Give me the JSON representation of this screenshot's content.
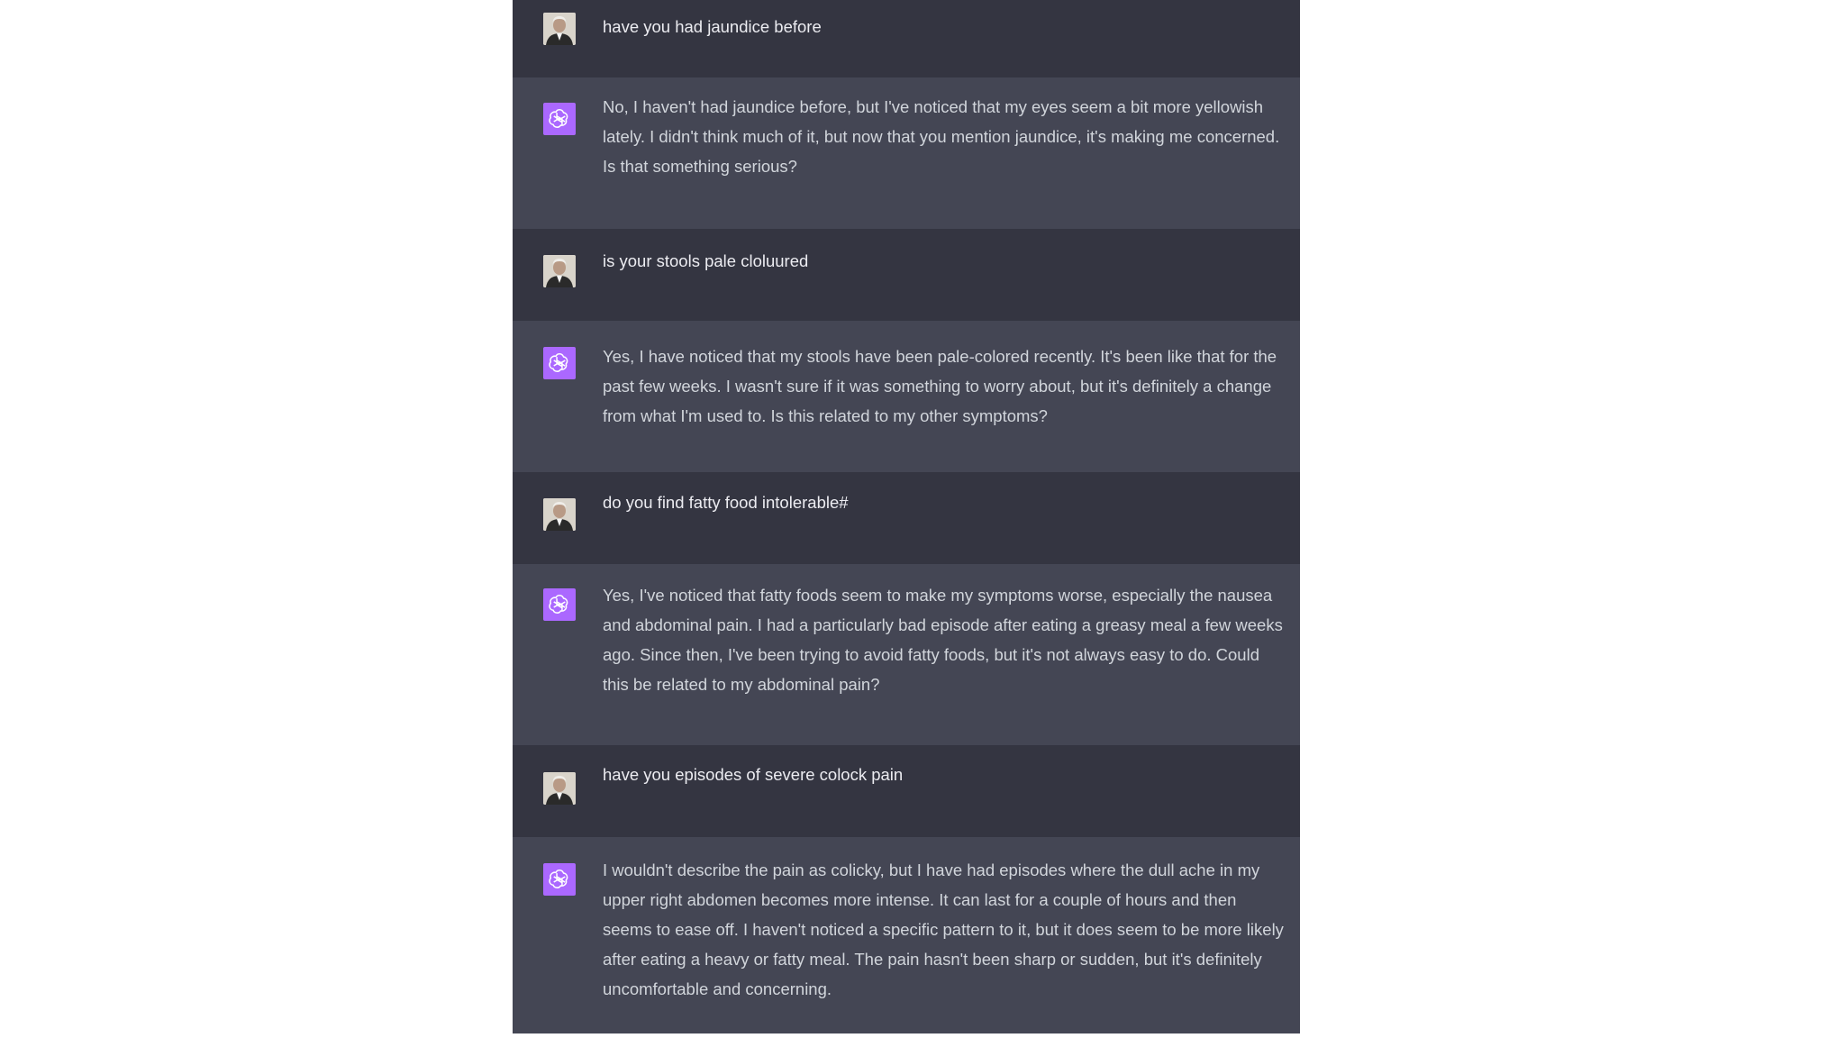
{
  "conversation": {
    "messages": [
      {
        "role": "user",
        "text": "have you had jaundice before"
      },
      {
        "role": "assistant",
        "text": "No, I haven't had jaundice before, but I've noticed that my eyes seem a bit more yellowish lately. I didn't think much of it, but now that you mention jaundice, it's making me concerned. Is that something serious?"
      },
      {
        "role": "user",
        "text": "is your stools pale cloluured"
      },
      {
        "role": "assistant",
        "text": "Yes, I have noticed that my stools have been pale-colored recently. It's been like that for the past few weeks. I wasn't sure if it was something to worry about, but it's definitely a change from what I'm used to. Is this related to my other symptoms?"
      },
      {
        "role": "user",
        "text": "do you find fatty food intolerable#"
      },
      {
        "role": "assistant",
        "text": "Yes, I've noticed that fatty foods seem to make my symptoms worse, especially the nausea and abdominal pain. I had a particularly bad episode after eating a greasy meal a few weeks ago. Since then, I've been trying to avoid fatty foods, but it's not always easy to do. Could this be related to my abdominal pain?"
      },
      {
        "role": "user",
        "text": "have you episodes of severe colock pain"
      },
      {
        "role": "assistant",
        "text": "I wouldn't describe the pain as colicky, but I have had episodes where the dull ache in my upper right abdomen becomes more intense. It can last for a couple of hours and then seems to ease off. I haven't noticed a specific pattern to it, but it does seem to be more likely after eating a heavy or fatty meal. The pain hasn't been sharp or sudden, but it's definitely uncomfortable and concerning."
      }
    ]
  },
  "colors": {
    "user_row_bg": "#343541",
    "assistant_row_bg": "#444654",
    "assistant_avatar_bg": "#ab68ff",
    "page_bg": "#ffffff"
  },
  "icons": {
    "user_avatar": "user-photo-avatar",
    "assistant_avatar": "openai-logo-icon"
  }
}
